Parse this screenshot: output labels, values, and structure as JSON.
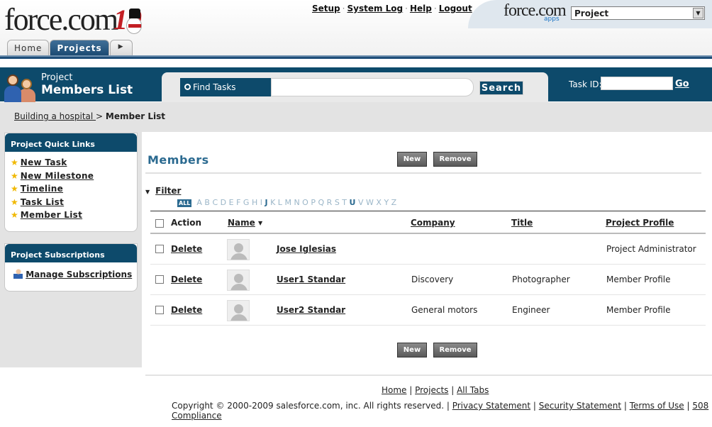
{
  "header": {
    "logo_text": "force.com",
    "logo_badge": "10",
    "top_links": [
      "Setup",
      "System Log",
      "Help",
      "Logout"
    ],
    "apps_logo": "force.com",
    "apps_sub": "apps",
    "app_selector": "Project"
  },
  "tabs": [
    {
      "label": "Home",
      "active": false
    },
    {
      "label": "Projects",
      "active": true
    }
  ],
  "page": {
    "title_small": "Project",
    "title_large": "Members List"
  },
  "search": {
    "label": "Find Tasks",
    "value": "",
    "button": "Search",
    "task_id_label": "Task ID:",
    "task_id_value": "",
    "go_label": "Go"
  },
  "breadcrumb": {
    "parent": "Building a hospital ",
    "separator": ">",
    "current": "Member List"
  },
  "sidebar": {
    "quick_links_title": "Project Quick Links",
    "quick_links": [
      "New Task",
      "New Milestone",
      "Timeline",
      "Task List",
      "Member List"
    ],
    "subscriptions_title": "Project Subscriptions",
    "manage_subscriptions": "Manage Subscriptions"
  },
  "members": {
    "title": "Members",
    "new_label": "New",
    "remove_label": "Remove",
    "filter_label": "Filter",
    "alpha_all": "ALL",
    "alpha": [
      "A",
      "B",
      "C",
      "D",
      "E",
      "F",
      "G",
      "H",
      "I",
      "J",
      "K",
      "L",
      "M",
      "N",
      "O",
      "P",
      "Q",
      "R",
      "S",
      "T",
      "U",
      "V",
      "W",
      "X",
      "Y",
      "Z"
    ],
    "alpha_active": [
      "J",
      "U"
    ],
    "columns": {
      "action": "Action",
      "name": "Name",
      "company": "Company",
      "title": "Title",
      "profile": "Project Profile"
    },
    "rows": [
      {
        "action": "Delete",
        "name": "Jose Iglesias",
        "company": "",
        "title": "",
        "profile": "Project Administrator"
      },
      {
        "action": "Delete",
        "name": "User1 Standar",
        "company": "Discovery",
        "title": "Photographer",
        "profile": "Member Profile"
      },
      {
        "action": "Delete",
        "name": "User2 Standar",
        "company": "General motors",
        "title": "Engineer",
        "profile": "Member Profile"
      }
    ]
  },
  "footer": {
    "links": [
      "Home",
      "Projects",
      "All Tabs"
    ],
    "copyright": "Copyright © 2000-2009 salesforce.com, inc. All rights reserved.",
    "legal_links": [
      "Privacy Statement",
      "Security Statement",
      "Terms of Use",
      "508 Compliance"
    ]
  }
}
